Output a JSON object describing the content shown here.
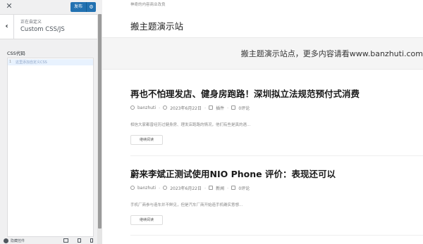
{
  "sidebar": {
    "publish_label": "发布",
    "crumb": "正在自定义",
    "title": "Custom CSS/JS",
    "css_label": "CSS代码",
    "editor_line_number": "1",
    "editor_placeholder": "这里添加自定义CSS",
    "hide_controls_label": "隐藏控件"
  },
  "preview": {
    "tagline": "神奇的内容商业改良",
    "site_title": "搬主题演示站",
    "banner_text": "搬主题演示站点，更多内容请看www.banzhuti.com",
    "posts": [
      {
        "title": "再也不怕理发店、健身房跑路！深圳拟立法规范预付式消费",
        "author": "banzhuti",
        "date": "2023年6月22日",
        "category": "插件",
        "comments": "0评论",
        "excerpt": "相信大家都曾经历过健身房、理发店跑路的情况，他们有些是真的遇...",
        "more": "继续阅读"
      },
      {
        "title": "蔚来李斌正测试使用NIO Phone 评价：表现还可以",
        "author": "banzhuti",
        "date": "2023年6月22日",
        "category": "新闻",
        "comments": "0评论",
        "excerpt": "手机厂商参与造车并不鲜见，但是汽车厂商开始造手机确实意想...",
        "more": "继续阅读"
      }
    ]
  }
}
